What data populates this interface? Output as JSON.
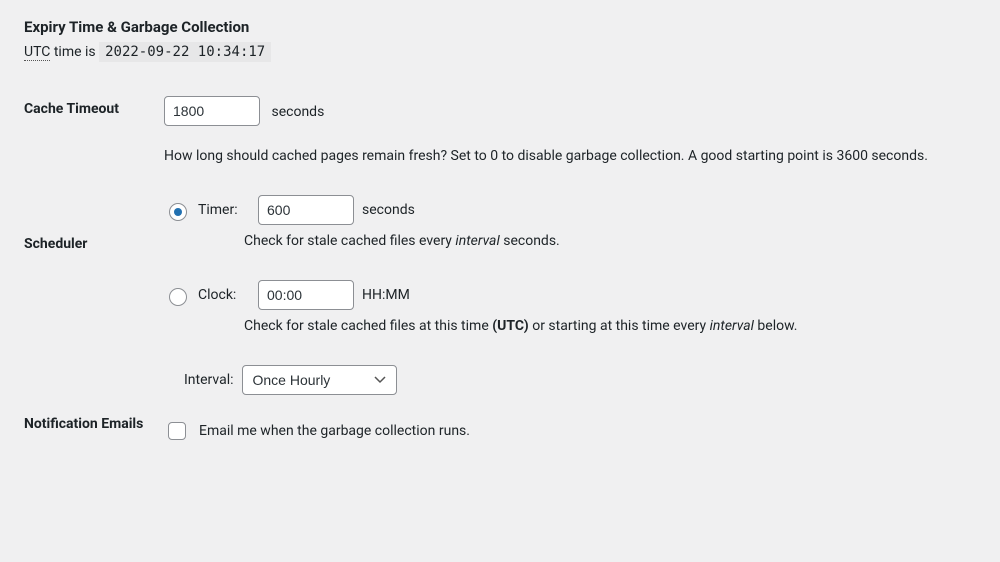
{
  "section_title": "Expiry Time & Garbage Collection",
  "utc": {
    "abbr": "UTC",
    "prefix": " time is ",
    "timestamp": "2022-09-22 10:34:17"
  },
  "cache_timeout": {
    "label": "Cache Timeout",
    "value": "1800",
    "unit": "seconds",
    "description": "How long should cached pages remain fresh? Set to 0 to disable garbage collection. A good starting point is 3600 seconds."
  },
  "scheduler": {
    "label": "Scheduler",
    "timer": {
      "radio_label": "Timer:",
      "value": "600",
      "unit": "seconds",
      "checked": true,
      "sub_pre": "Check for stale cached files every ",
      "sub_em": "interval",
      "sub_post": " seconds."
    },
    "clock": {
      "radio_label": "Clock:",
      "value": "00:00",
      "unit": "HH:MM",
      "checked": false,
      "sub_pre": "Check for stale cached files at this time ",
      "sub_b": "(UTC)",
      "sub_mid": " or starting at this time every ",
      "sub_em": "interval",
      "sub_post": " below."
    },
    "interval": {
      "label": "Interval:",
      "selected": "Once Hourly"
    }
  },
  "notification": {
    "label": "Notification Emails",
    "checkbox_label": "Email me when the garbage collection runs."
  }
}
